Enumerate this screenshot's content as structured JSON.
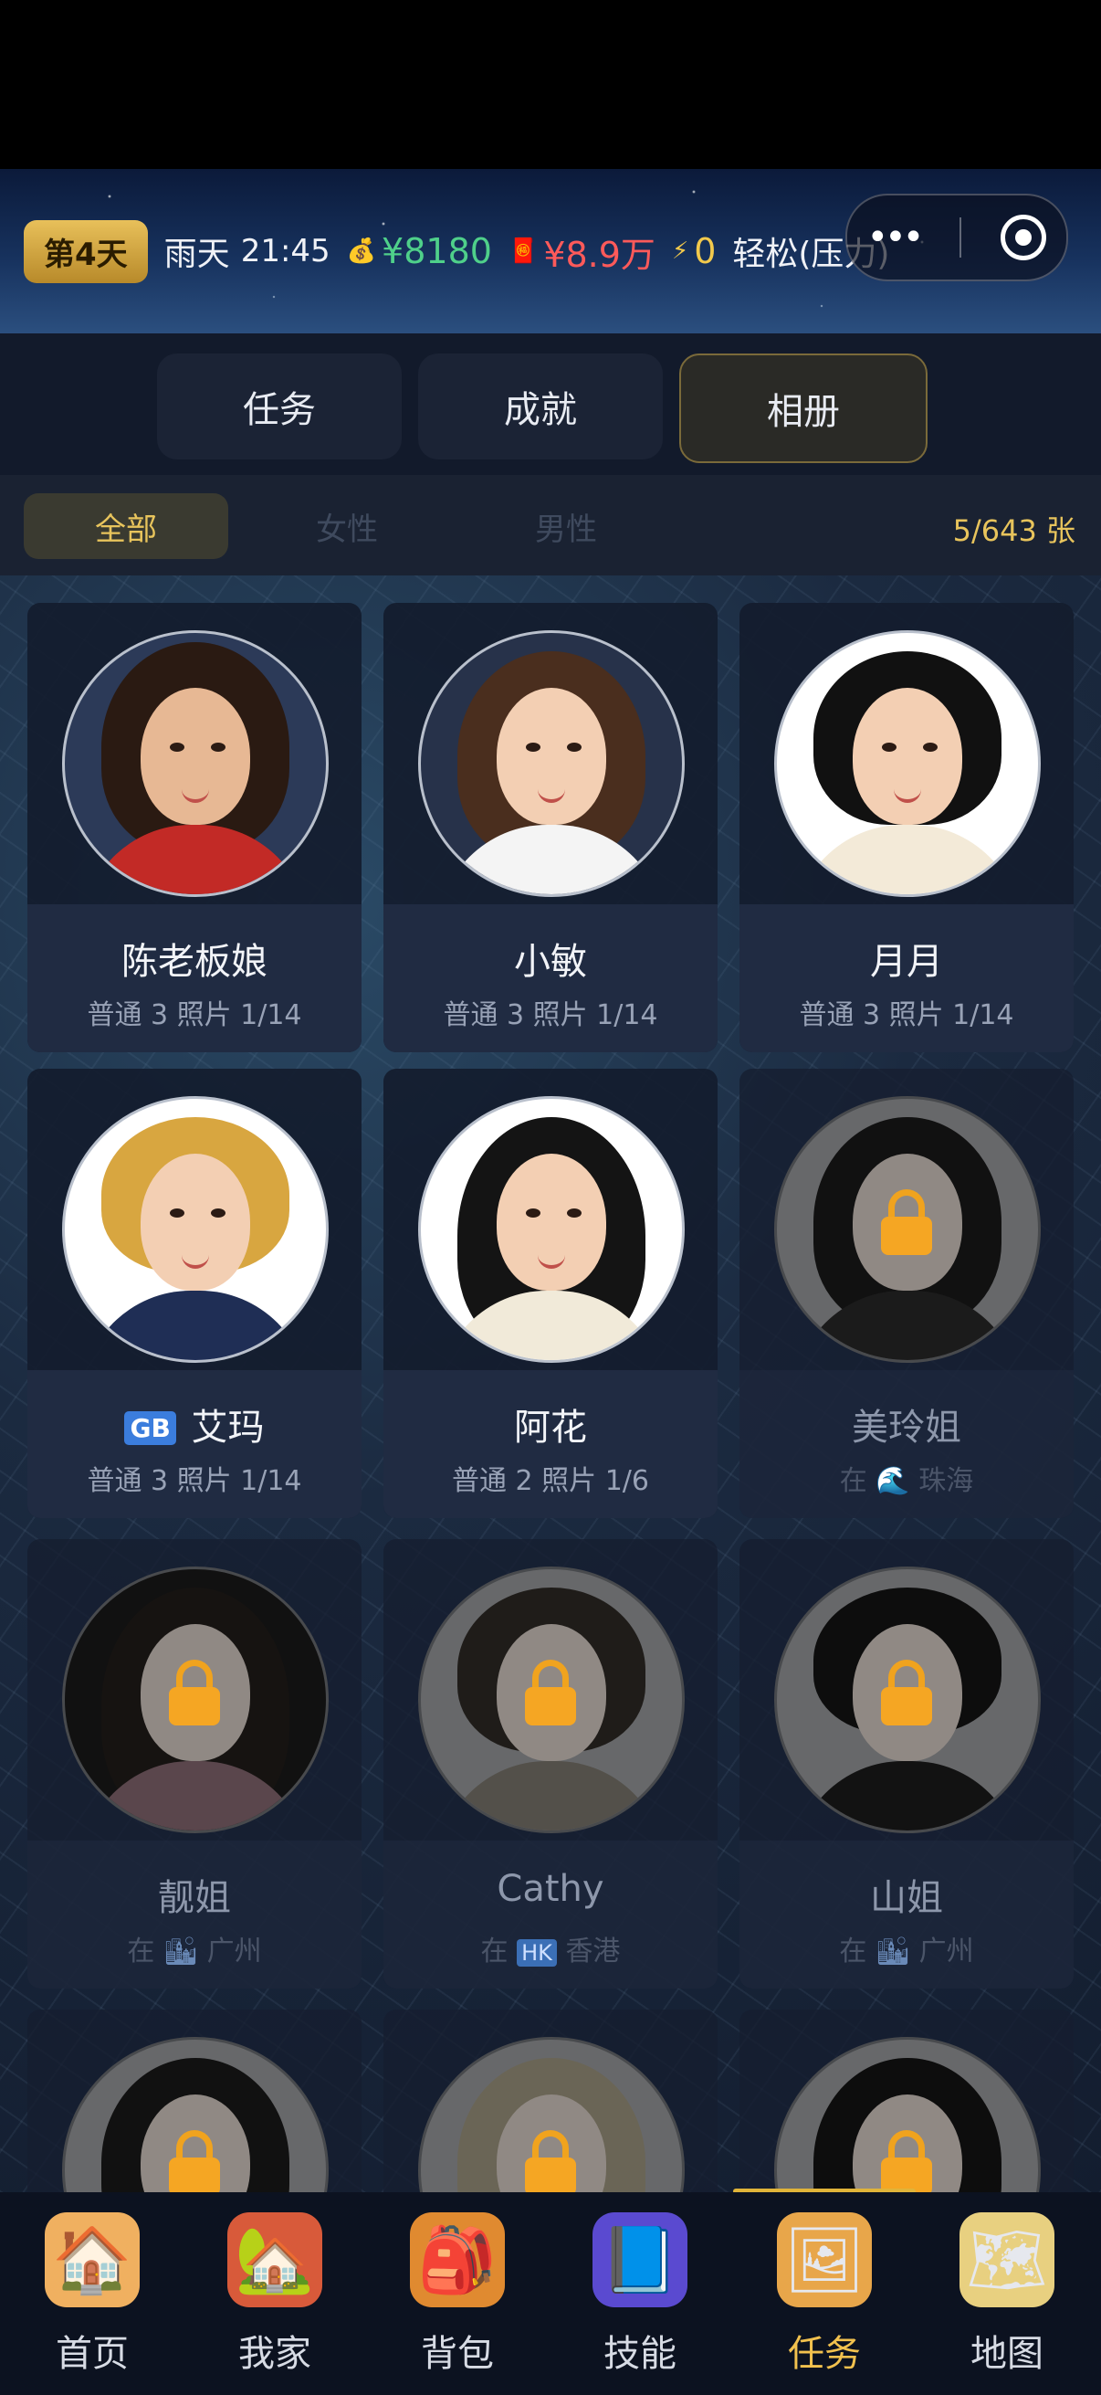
{
  "status": {
    "day": "第4天",
    "weather": "雨天",
    "time": "21:45",
    "money": "¥8180",
    "debt": "¥8.9万",
    "energy": "0",
    "mood": "轻松(压力)"
  },
  "tabs": [
    {
      "label": "任务",
      "active": false
    },
    {
      "label": "成就",
      "active": false
    },
    {
      "label": "相册",
      "active": true
    }
  ],
  "filters": [
    {
      "label": "全部",
      "active": true
    },
    {
      "label": "女性",
      "active": false
    },
    {
      "label": "男性",
      "active": false
    }
  ],
  "photo_count": "5/643 张",
  "cards": [
    {
      "name": "陈老板娘",
      "sub": "普通 3   照片 1/14",
      "locked": false
    },
    {
      "name": "小敏",
      "sub": "普通 3   照片 1/14",
      "locked": false
    },
    {
      "name": "月月",
      "sub": "普通 3   照片 1/14",
      "locked": false
    },
    {
      "name_flag": "GB",
      "name": "艾玛",
      "sub": "普通 3   照片 1/14",
      "locked": false
    },
    {
      "name": "阿花",
      "sub": "普通 2   照片 1/6",
      "locked": false
    },
    {
      "name": "美玲姐",
      "sub_prefix": "在",
      "sub": "珠海",
      "locked": true
    },
    {
      "name": "靓姐",
      "sub_prefix": "在",
      "sub": "广州",
      "locked": true
    },
    {
      "name": "Cathy",
      "sub_prefix": "在",
      "sub_flag": "HK",
      "sub": "香港",
      "locked": true
    },
    {
      "name": "山姐",
      "sub_prefix": "在",
      "sub": "广州",
      "locked": true
    }
  ],
  "nav": [
    {
      "label": "首页",
      "icon": "house-icon",
      "active": false
    },
    {
      "label": "我家",
      "icon": "home-icon",
      "active": false
    },
    {
      "label": "背包",
      "icon": "backpack-icon",
      "active": false
    },
    {
      "label": "技能",
      "icon": "skill-book-icon",
      "active": false
    },
    {
      "label": "任务",
      "icon": "photo-album-icon",
      "active": true
    },
    {
      "label": "地图",
      "icon": "map-icon",
      "active": false
    }
  ]
}
